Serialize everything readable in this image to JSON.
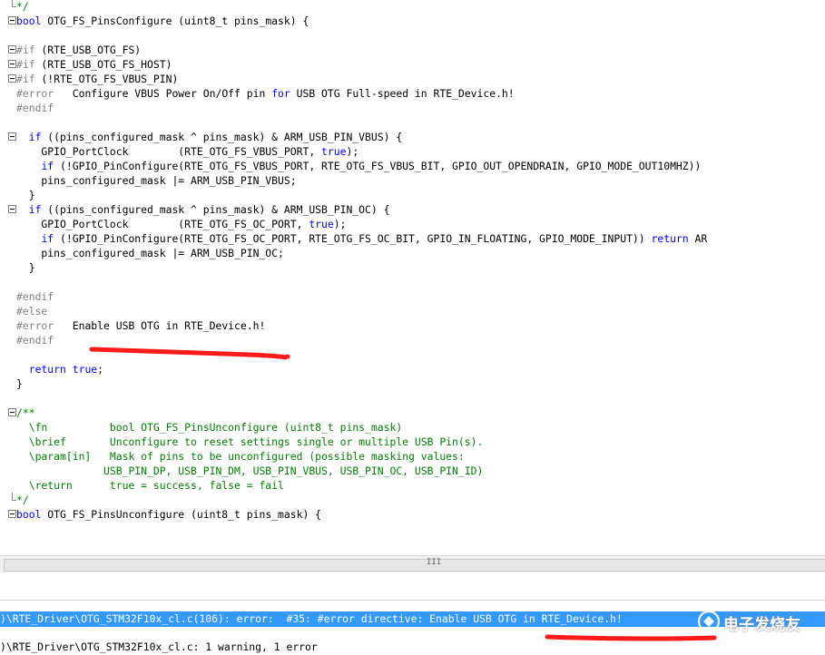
{
  "editor": {
    "lines": [
      {
        "num": "",
        "fold": "end",
        "segments": [
          {
            "t": "*/",
            "c": "cm"
          }
        ]
      },
      {
        "num": "",
        "fold": "open",
        "segments": [
          {
            "t": "bool",
            "c": "kw"
          },
          {
            "t": " OTG_FS_PinsConfigure (uint8_t pins_mask) {",
            "c": ""
          }
        ]
      },
      {
        "num": "",
        "fold": "",
        "segments": []
      },
      {
        "num": "",
        "fold": "open",
        "segments": [
          {
            "t": "#if",
            "c": "pp"
          },
          {
            "t": " (RTE_USB_OTG_FS)",
            "c": ""
          }
        ]
      },
      {
        "num": "",
        "fold": "open",
        "segments": [
          {
            "t": "#if",
            "c": "pp"
          },
          {
            "t": " (RTE_USB_OTG_FS_HOST)",
            "c": ""
          }
        ]
      },
      {
        "num": "",
        "fold": "open",
        "segments": [
          {
            "t": "#if",
            "c": "pp"
          },
          {
            "t": " (!RTE_OTG_FS_VBUS_PIN)",
            "c": ""
          }
        ]
      },
      {
        "num": "",
        "fold": "",
        "segments": [
          {
            "t": "#error",
            "c": "pp"
          },
          {
            "t": "   Configure VBUS Power On/Off pin ",
            "c": ""
          },
          {
            "t": "for",
            "c": "kw"
          },
          {
            "t": " USB OTG Full-speed in RTE_Device.h!",
            "c": ""
          }
        ]
      },
      {
        "num": "",
        "fold": "",
        "segments": [
          {
            "t": "#endif",
            "c": "pp"
          }
        ]
      },
      {
        "num": "",
        "fold": "",
        "segments": []
      },
      {
        "num": "",
        "fold": "open",
        "segments": [
          {
            "t": "  ",
            "c": ""
          },
          {
            "t": "if",
            "c": "kw"
          },
          {
            "t": " ((pins_configured_mask ^ pins_mask) & ARM_USB_PIN_VBUS) {",
            "c": ""
          }
        ]
      },
      {
        "num": "",
        "fold": "",
        "segments": [
          {
            "t": "    GPIO_PortClock        (RTE_OTG_FS_VBUS_PORT, ",
            "c": ""
          },
          {
            "t": "true",
            "c": "kw"
          },
          {
            "t": ");",
            "c": ""
          }
        ]
      },
      {
        "num": "",
        "fold": "",
        "segments": [
          {
            "t": "    ",
            "c": ""
          },
          {
            "t": "if",
            "c": "kw"
          },
          {
            "t": " (!GPIO_PinConfigure(RTE_OTG_FS_VBUS_PORT, RTE_OTG_FS_VBUS_BIT, GPIO_OUT_OPENDRAIN, GPIO_MODE_OUT10MHZ))",
            "c": ""
          }
        ]
      },
      {
        "num": "",
        "fold": "",
        "segments": [
          {
            "t": "    pins_configured_mask |= ARM_USB_PIN_VBUS;",
            "c": ""
          }
        ]
      },
      {
        "num": "",
        "fold": "",
        "segments": [
          {
            "t": "  }",
            "c": ""
          }
        ]
      },
      {
        "num": "",
        "fold": "open",
        "segments": [
          {
            "t": "  ",
            "c": ""
          },
          {
            "t": "if",
            "c": "kw"
          },
          {
            "t": " ((pins_configured_mask ^ pins_mask) & ARM_USB_PIN_OC) {",
            "c": ""
          }
        ]
      },
      {
        "num": "",
        "fold": "",
        "segments": [
          {
            "t": "    GPIO_PortClock        (RTE_OTG_FS_OC_PORT, ",
            "c": ""
          },
          {
            "t": "true",
            "c": "kw"
          },
          {
            "t": ");",
            "c": ""
          }
        ]
      },
      {
        "num": "",
        "fold": "",
        "segments": [
          {
            "t": "    ",
            "c": ""
          },
          {
            "t": "if",
            "c": "kw"
          },
          {
            "t": " (!GPIO_PinConfigure(RTE_OTG_FS_OC_PORT, RTE_OTG_FS_OC_BIT, GPIO_IN_FLOATING, GPIO_MODE_INPUT)) ",
            "c": ""
          },
          {
            "t": "return",
            "c": "kw"
          },
          {
            "t": " AR",
            "c": ""
          }
        ]
      },
      {
        "num": "",
        "fold": "",
        "segments": [
          {
            "t": "    pins_configured_mask |= ARM_USB_PIN_OC;",
            "c": ""
          }
        ]
      },
      {
        "num": "",
        "fold": "",
        "segments": [
          {
            "t": "  }",
            "c": ""
          }
        ]
      },
      {
        "num": "",
        "fold": "",
        "segments": []
      },
      {
        "num": "",
        "fold": "",
        "segments": [
          {
            "t": "#endif",
            "c": "pp"
          }
        ]
      },
      {
        "num": "",
        "fold": "",
        "segments": [
          {
            "t": "#else",
            "c": "pp"
          }
        ]
      },
      {
        "num": "",
        "fold": "",
        "segments": [
          {
            "t": "#error",
            "c": "pp"
          },
          {
            "t": "   Enable USB OTG in RTE_Device.h!",
            "c": ""
          }
        ]
      },
      {
        "num": "",
        "fold": "",
        "segments": [
          {
            "t": "#endif",
            "c": "pp"
          }
        ]
      },
      {
        "num": "",
        "fold": "",
        "segments": []
      },
      {
        "num": "",
        "fold": "",
        "segments": [
          {
            "t": "  ",
            "c": ""
          },
          {
            "t": "return",
            "c": "kw"
          },
          {
            "t": " ",
            "c": ""
          },
          {
            "t": "true",
            "c": "kw"
          },
          {
            "t": ";",
            "c": ""
          }
        ]
      },
      {
        "num": "",
        "fold": "",
        "segments": [
          {
            "t": "}",
            "c": ""
          }
        ]
      },
      {
        "num": "",
        "fold": "",
        "segments": []
      },
      {
        "num": "",
        "fold": "open",
        "segments": [
          {
            "t": "/**",
            "c": "cm"
          }
        ]
      },
      {
        "num": "",
        "fold": "",
        "segments": [
          {
            "t": "  \\fn          bool OTG_FS_PinsUnconfigure (uint8_t pins_mask)",
            "c": "cm"
          }
        ]
      },
      {
        "num": "",
        "fold": "",
        "segments": [
          {
            "t": "  \\brief       Unconfigure to reset settings single or multiple USB Pin(s).",
            "c": "cm"
          }
        ]
      },
      {
        "num": "",
        "fold": "",
        "segments": [
          {
            "t": "  \\param[in]   Mask of pins to be unconfigured (possible masking values:",
            "c": "cm"
          }
        ]
      },
      {
        "num": "",
        "fold": "",
        "segments": [
          {
            "t": "              USB_PIN_DP, USB_PIN_DM, USB_PIN_VBUS, USB_PIN_OC, USB_PIN_ID)",
            "c": "cm"
          }
        ]
      },
      {
        "num": "",
        "fold": "",
        "segments": [
          {
            "t": "  \\return      true = success, false = fail",
            "c": "cm"
          }
        ]
      },
      {
        "num": "",
        "fold": "end",
        "segments": [
          {
            "t": "*/",
            "c": "cm"
          }
        ]
      },
      {
        "num": "",
        "fold": "open",
        "segments": [
          {
            "t": "bool",
            "c": "kw"
          },
          {
            "t": " OTG_FS_PinsUnconfigure (uint8_t pins_mask) {",
            "c": ""
          }
        ]
      },
      {
        "num": "",
        "fold": "",
        "segments": []
      },
      {
        "num": "",
        "fold": "",
        "segments": []
      }
    ]
  },
  "scrollbar": {
    "grip": "III"
  },
  "build_output": {
    "error_line": ")\\RTE_Driver\\OTG_STM32F10x_cl.c(106): error:  #35: #error directive: Enable USB OTG in RTE_Device.h!",
    "summary_line": ")\\RTE_Driver\\OTG_STM32F10x_cl.c: 1 warning, 1 error"
  },
  "watermark": {
    "text": "电子发烧友"
  },
  "colors": {
    "keyword": "#0000ff",
    "preprocessor": "#808080",
    "comment": "#008000",
    "selection": "#3399ff",
    "annotation": "#ff0000"
  }
}
